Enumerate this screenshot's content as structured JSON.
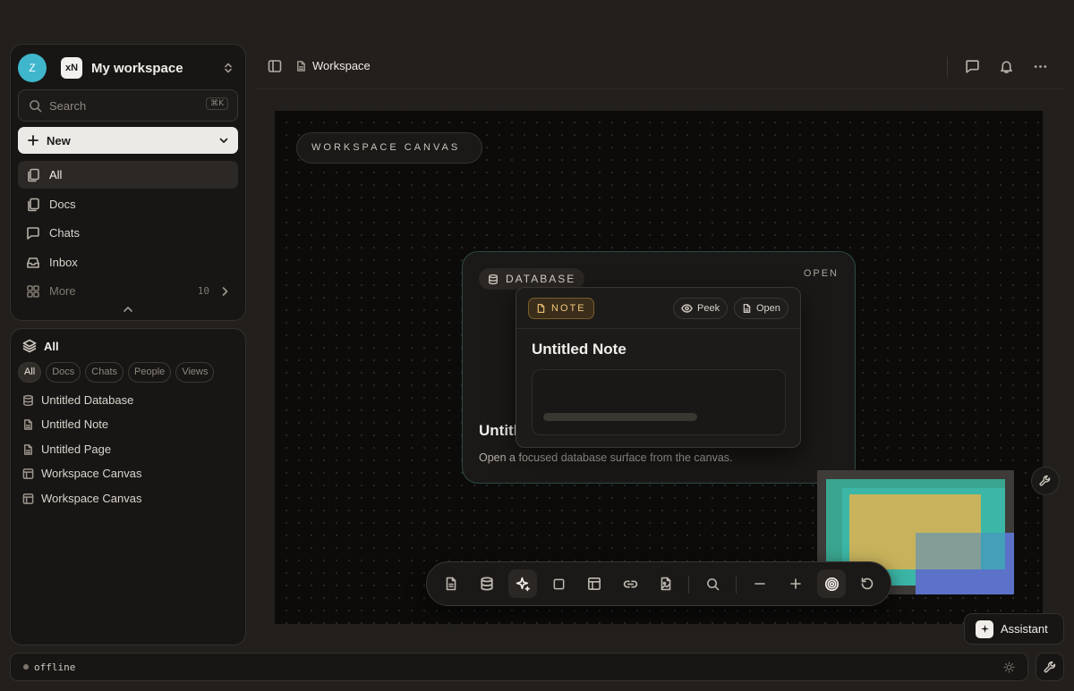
{
  "workspace": {
    "avatar_initial": "Z",
    "logo_text": "xN",
    "name": "My workspace"
  },
  "search": {
    "placeholder": "Search",
    "shortcut": "⌘K"
  },
  "new_button": {
    "label": "New"
  },
  "nav": {
    "items": [
      {
        "label": "All",
        "icon": "copy-icon",
        "active": true
      },
      {
        "label": "Docs",
        "icon": "docs-icon"
      },
      {
        "label": "Chats",
        "icon": "chat-icon"
      },
      {
        "label": "Inbox",
        "icon": "inbox-icon"
      },
      {
        "label": "More",
        "icon": "grid-icon",
        "count": "10"
      }
    ]
  },
  "library": {
    "title": "All",
    "filters": [
      "All",
      "Docs",
      "Chats",
      "People",
      "Views"
    ],
    "active_filter": "All",
    "items": [
      {
        "label": "Untitled Database",
        "icon": "database-icon"
      },
      {
        "label": "Untitled Note",
        "icon": "document-icon"
      },
      {
        "label": "Untitled Page",
        "icon": "document-icon"
      },
      {
        "label": "Workspace Canvas",
        "icon": "layout-icon"
      },
      {
        "label": "Workspace Canvas",
        "icon": "layout-icon"
      }
    ]
  },
  "header": {
    "breadcrumb": "Workspace"
  },
  "canvas": {
    "label": "WORKSPACE CANVAS",
    "database_card": {
      "tag": "DATABASE",
      "open_label": "OPEN",
      "title": "Untitl",
      "description": "Open a focused database surface from the canvas."
    },
    "note_card": {
      "tag": "NOTE",
      "peek_label": "Peek",
      "open_label": "Open",
      "title": "Untitled Note"
    }
  },
  "assistant": {
    "label": "Assistant"
  },
  "status": {
    "text": "offline"
  },
  "colors": {
    "background": "#221f1c",
    "panel": "#181614",
    "avatar": "#3fb6cc",
    "note_accent": "#f0c578",
    "thumb_teal": "#3aa58f",
    "thumb_yellow": "#c8b35c",
    "thumb_blue": "#5b72c8"
  }
}
